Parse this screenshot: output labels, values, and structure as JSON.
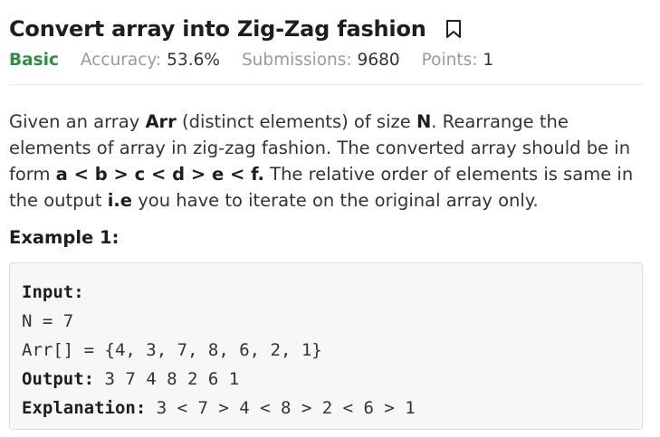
{
  "problem": {
    "title": "Convert array into Zig-Zag fashion",
    "difficulty": "Basic",
    "accuracy_label": "Accuracy:",
    "accuracy_value": "53.6%",
    "submissions_label": "Submissions:",
    "submissions_value": "9680",
    "points_label": "Points:",
    "points_value": "1"
  },
  "description": {
    "p1": "Given an array ",
    "p2": "Arr",
    "p3": " (distinct elements) of size ",
    "p4": "N",
    "p5": ". Rearrange the elements of array in zig-zag fashion. The converted array should be in form ",
    "p6": "a < b > c < d > e < f.",
    "p7": " The relative order of elements is same in the output ",
    "p8": "i.e",
    "p9": " you have to iterate on the original array only."
  },
  "example": {
    "heading": "Example 1:",
    "input_label": "Input:",
    "n_line": "N = 7",
    "arr_line": "Arr[] = {4, 3, 7, 8, 6, 2, 1}",
    "output_label": "Output:",
    "output_value": " 3 7 4 8 2 6 1",
    "explanation_label": "Explanation:",
    "explanation_value": " 3 < 7 > 4 < 8 > 2 < 6 > 1"
  },
  "colors": {
    "basic": "#2f8d46",
    "muted": "#9a9a9a",
    "code_bg": "#f7f7f7"
  },
  "icons": {
    "bookmark": "bookmark-icon"
  }
}
